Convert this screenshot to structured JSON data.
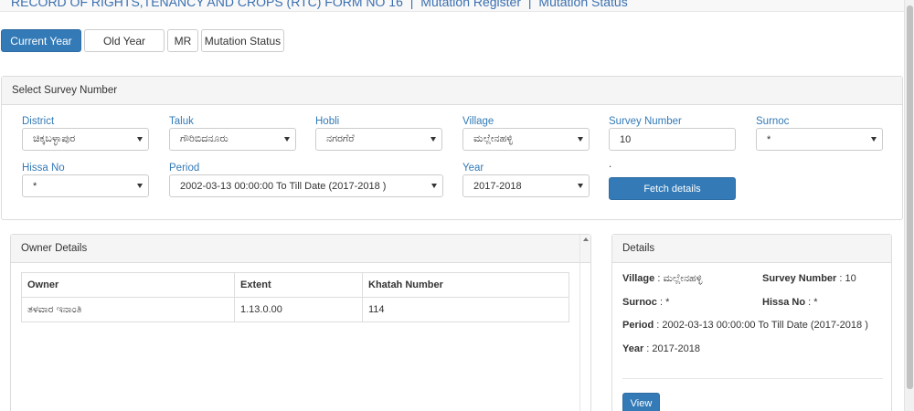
{
  "header": {
    "title": "RECORD OF RIGHTS,TENANCY AND CROPS (RTC) FORM NO 16",
    "links": [
      "Mutation Register",
      "Mutation Status"
    ],
    "separator": "|"
  },
  "tabs": [
    {
      "label": "Current Year",
      "active": true
    },
    {
      "label": "Old Year",
      "active": false
    },
    {
      "label": "MR",
      "active": false
    },
    {
      "label": "Mutation Status",
      "active": false
    }
  ],
  "survey_panel": {
    "heading": "Select Survey Number",
    "district": {
      "label": "District",
      "value": "ಚಿಕ್ಕಬಳ್ಳಾಪುರ"
    },
    "taluk": {
      "label": "Taluk",
      "value": "ಗೌರಿಬಿದನೂರು"
    },
    "hobli": {
      "label": "Hobli",
      "value": "ನಗರಗೆರೆ"
    },
    "village": {
      "label": "Village",
      "value": "ಮಲ್ಲೇನಹಳ್ಳಿ"
    },
    "survey_number": {
      "label": "Survey Number",
      "value": "10"
    },
    "surnoc": {
      "label": "Surnoc",
      "value": "*"
    },
    "hissa_no": {
      "label": "Hissa No",
      "value": "*"
    },
    "period": {
      "label": "Period",
      "value": "2002-03-13 00:00:00 To Till Date (2017-2018 )"
    },
    "year": {
      "label": "Year",
      "value": "2017-2018"
    },
    "fetch_label": ".",
    "fetch_button": "Fetch details"
  },
  "owner_panel": {
    "heading": "Owner Details",
    "columns": [
      "Owner",
      "Extent",
      "Khatah Number"
    ],
    "rows": [
      [
        "ತಳವಾರ ಇನಾಂತಿ",
        "1.13.0.00",
        "114"
      ]
    ]
  },
  "details_panel": {
    "heading": "Details",
    "village_label": "Village",
    "village_value": "ಮಲ್ಲೇನಹಳ್ಳಿ",
    "survey_label": "Survey Number",
    "survey_value": "10",
    "surnoc_label": "Surnoc",
    "surnoc_value": "*",
    "hissa_label": "Hissa No",
    "hissa_value": "*",
    "period_label": "Period",
    "period_value": "2002-03-13 00:00:00 To Till Date (2017-2018 )",
    "year_label": "Year",
    "year_value": "2017-2018",
    "view_button": "View"
  },
  "colors": {
    "primary": "#337ab7",
    "link": "#3a6fb0"
  }
}
